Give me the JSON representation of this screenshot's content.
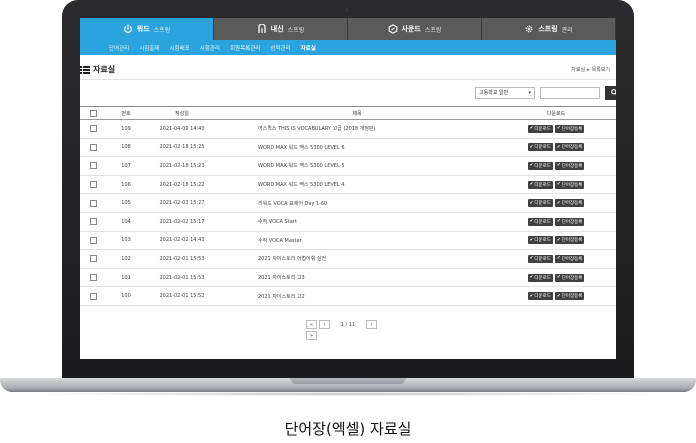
{
  "caption": "단어장(엑셀) 자료실",
  "topnav": [
    {
      "label": "워드",
      "sub": "스프링",
      "icon": "power-icon",
      "active": true
    },
    {
      "label": "내신",
      "sub": "스프링",
      "icon": "n-logo-icon",
      "active": false
    },
    {
      "label": "사운드",
      "sub": "스프링",
      "icon": "hexagon-icon",
      "active": false
    },
    {
      "label": "스프링",
      "sub": "관리",
      "icon": "gear-icon",
      "active": false
    }
  ],
  "subnav": [
    "단어관리",
    "시험출제",
    "시험배포",
    "시험관리",
    "회원목록관리",
    "성적관리",
    "자료실"
  ],
  "page": {
    "title": "자료실",
    "breadcrumb": [
      "자료실",
      "목록보기"
    ]
  },
  "filter": {
    "select_value": "고등학교 일반",
    "search_placeholder": "",
    "search_value": ""
  },
  "table": {
    "headers": {
      "num": "번호",
      "date": "작성일",
      "title": "제목",
      "download": "다운로드"
    },
    "download_label": "다운로드",
    "register_label": "단어장등록",
    "rows": [
      {
        "num": "109",
        "date": "2021-04-09 14:40",
        "title": "어스퀵스 THIS IS VOCABULARY 고급 (2018 개정판)"
      },
      {
        "num": "108",
        "date": "2021-02-18 15:25",
        "title": "WORD MAX 워드 맥스 5300 LEVEL 6"
      },
      {
        "num": "107",
        "date": "2021-02-18 15:23",
        "title": "WORD MAX 워드 맥스 5300 LEVEL 5"
      },
      {
        "num": "106",
        "date": "2021-02-18 15:22",
        "title": "WORD MAX 워드 맥스 5300 LEVEL 4"
      },
      {
        "num": "105",
        "date": "2021-02-03 15:27",
        "title": "리워드 VOCA 표제어 Day 1-60"
      },
      {
        "num": "104",
        "date": "2021-02-02 15:17",
        "title": "수작 VOCA Start"
      },
      {
        "num": "103",
        "date": "2021-02-02 14:43",
        "title": "수작 VOCA Master"
      },
      {
        "num": "102",
        "date": "2021-02-01 15:53",
        "title": "2021 자이스토리 어법어휘 실전"
      },
      {
        "num": "101",
        "date": "2021-02-01 15:53",
        "title": "2021 자이스토리 고3"
      },
      {
        "num": "100",
        "date": "2021-02-01 15:52",
        "title": "2021 자이스토리 고2"
      }
    ]
  },
  "pager": {
    "info": "1 / 11"
  },
  "colors": {
    "accent": "#2ba3dc",
    "nav_dark": "#4a4a4a",
    "button": "#404040"
  }
}
